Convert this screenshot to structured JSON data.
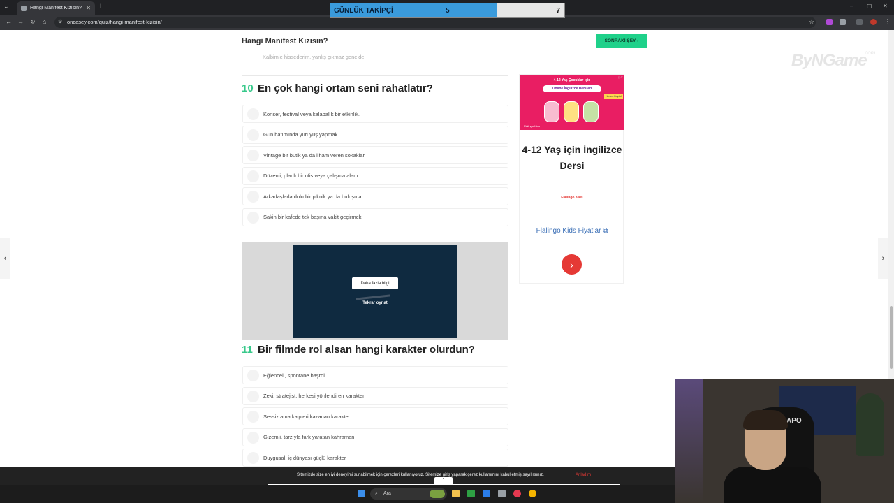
{
  "browser": {
    "tab_title": "Hangi Manifest Kızısın? – Oncasey",
    "url": "oncasey.com/quiz/hangi-manifest-kizisin/"
  },
  "overlay": {
    "label": "GÜNLÜK TAKİPÇİ",
    "current": "5",
    "goal": "7",
    "progress_fraction": 0.714
  },
  "header": {
    "quiz_title": "Hangi Manifest Kızısın?",
    "next_button": "SONRAKİ ŞEY"
  },
  "logo": {
    "text": "ByNGame",
    "suffix": ".com"
  },
  "previous_option": "Kalbimle hissederim, yanlış çıkmaz genelde.",
  "questions": [
    {
      "number": "10",
      "text": "En çok hangi ortam seni rahatlatır?",
      "options": [
        "Konser, festival veya kalabalık bir etkinlik.",
        "Gün batımında yürüyüş yapmak.",
        "Vintage bir butik ya da ilham veren sokaklar.",
        "Düzenli, planlı bir ofis veya çalışma alanı.",
        "Arkadaşlarla dolu bir piknik ya da buluşma.",
        "Sakin bir kafede tek başına vakit geçirmek."
      ]
    },
    {
      "number": "11",
      "text": "Bir filmde rol alsan hangi karakter olurdun?",
      "options": [
        "Eğlenceli, spontane başrol",
        "Zeki, stratejist, herkesi yönlendiren karakter",
        "Sessiz ama kalpleri kazanan karakter",
        "Gizemli, tarzıyla fark yaratan kahraman",
        "Duygusal, iç dünyası güçlü karakter"
      ]
    }
  ],
  "video_ad": {
    "more_info": "Daha fazla bilgi",
    "replay": "Tekrar oynat"
  },
  "side_ad": {
    "banner_line1": "4-12 Yaş Çocuklar için",
    "banner_line2": "Online İngilizce Dersleri",
    "banner_tag": "Hemen Kaydol",
    "banner_logo": "Flalingo Kids",
    "headline": "4-12 Yaş için İngilizce Dersi",
    "brand": "Flalingo Kids",
    "link": "Flalingo Kids Fiyatlar"
  },
  "cookie": {
    "text": "Sitemizde size en iyi deneyimi sunabilmek için çerezleri kullanıyoruz. Sitemize giriş yaparak çerez kullanımını kabul etmiş sayılırsınız.",
    "accept": "Anladım"
  },
  "taskbar": {
    "search_label": "Ara"
  },
  "colors": {
    "accent": "#38c98b",
    "next_button": "#1fd18a",
    "ad_pink": "#e91e63",
    "overlay_blue": "#3a9bdc"
  }
}
